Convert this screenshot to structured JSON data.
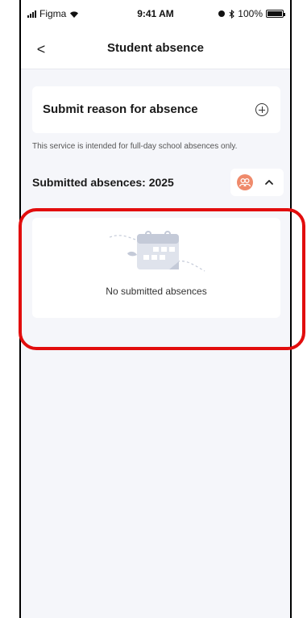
{
  "status_bar": {
    "carrier": "Figma",
    "time": "9:41 AM",
    "battery": "100%"
  },
  "nav": {
    "back_glyph": "<",
    "title": "Student absence"
  },
  "submit": {
    "label": "Submit reason for absence",
    "icon": "plus-circle-icon"
  },
  "notice": "This service is intended for full-day school absences only.",
  "submitted": {
    "title": "Submitted absences: 2025",
    "filter_icon": "people-icon",
    "toggle_icon": "chevron-up-icon"
  },
  "empty_state": {
    "illustration": "calendar-icon",
    "text": "No submitted absences"
  },
  "colors": {
    "background": "#f5f6fa",
    "card": "#ffffff",
    "avatar": "#ef8a6b",
    "highlight": "#e20d0d",
    "illustration": "#c4cad8"
  }
}
